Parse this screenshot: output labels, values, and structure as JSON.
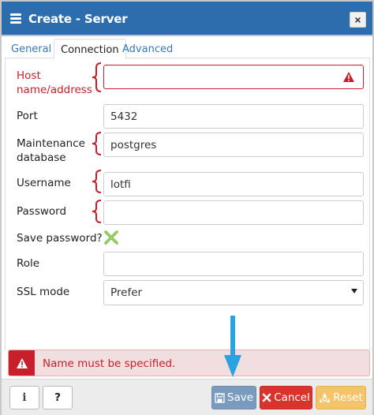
{
  "dialog": {
    "title": "Create - Server",
    "close_label": "×"
  },
  "tabs": [
    {
      "label": "General"
    },
    {
      "label": "Connection"
    },
    {
      "label": "Advanced"
    }
  ],
  "active_tab": "Connection",
  "fields": {
    "host": {
      "label": "Host name/address",
      "value": ""
    },
    "port": {
      "label": "Port",
      "value": "5432"
    },
    "maintenance_db": {
      "label": "Maintenance database",
      "value": "postgres"
    },
    "username": {
      "label": "Username",
      "value": "lotfi"
    },
    "password": {
      "label": "Password",
      "value": ""
    },
    "save_password": {
      "label": "Save password?",
      "checked": false
    },
    "role": {
      "label": "Role",
      "value": ""
    },
    "ssl_mode": {
      "label": "SSL mode",
      "value": "Prefer"
    }
  },
  "error": {
    "message": "Name must be specified."
  },
  "footer": {
    "info_label": "i",
    "help_label": "?",
    "save_label": "Save",
    "cancel_label": "Cancel",
    "reset_label": "Reset"
  },
  "colors": {
    "titlebar": "#2c6dad",
    "error": "#c7202a",
    "save": "#7a9bbd",
    "cancel": "#d9342b",
    "reset": "#f5c46a",
    "arrow": "#2aa3e0"
  }
}
